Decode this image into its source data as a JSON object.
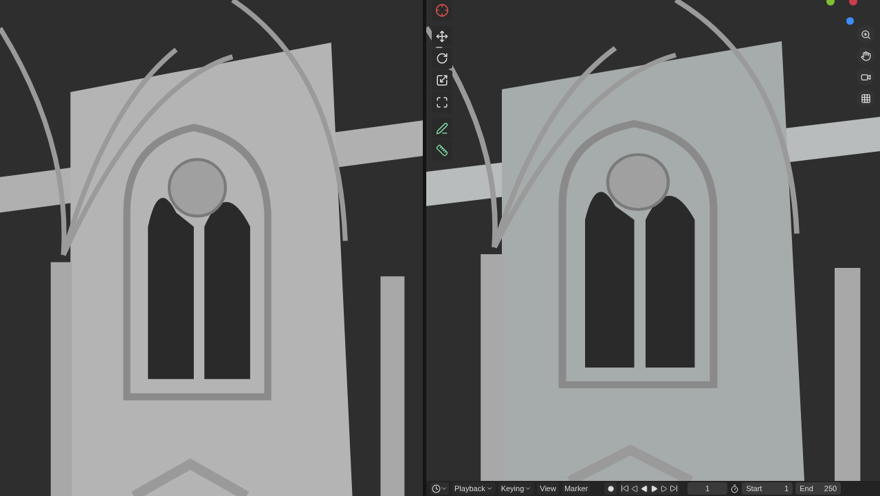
{
  "timeline": {
    "menus": [
      {
        "label": "Playback",
        "dropdown": true
      },
      {
        "label": "Keying",
        "dropdown": true
      },
      {
        "label": "View",
        "dropdown": false
      },
      {
        "label": "Marker",
        "dropdown": false
      }
    ],
    "current_frame": "1",
    "start": {
      "label": "Start",
      "value": "1"
    },
    "end": {
      "label": "End",
      "value": "250"
    }
  }
}
